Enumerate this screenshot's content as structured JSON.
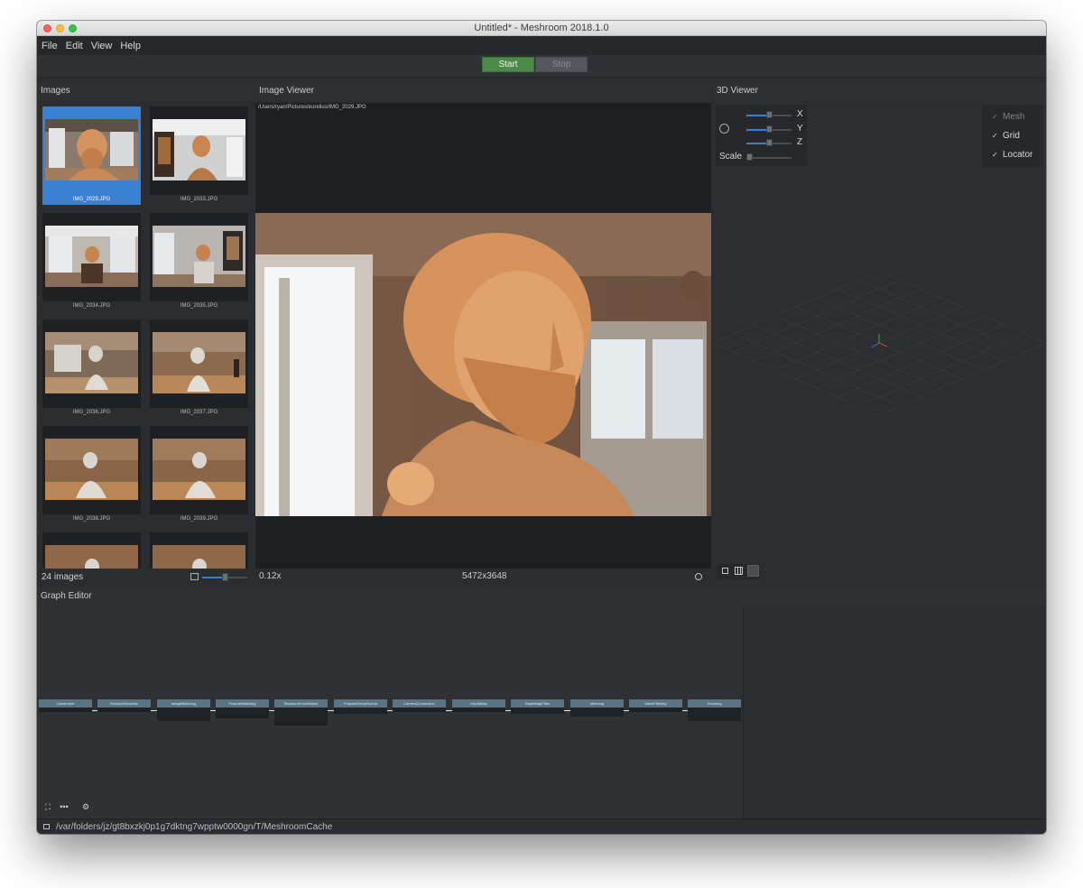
{
  "window": {
    "title": "Untitled* - Meshroom 2018.1.0"
  },
  "menu": [
    "File",
    "Edit",
    "View",
    "Help"
  ],
  "toolbar": {
    "start_label": "Start",
    "stop_label": "Stop"
  },
  "images_panel": {
    "title": "Images",
    "count_label": "24 images",
    "thumbnails": [
      {
        "name": "IMG_2029.JPG"
      },
      {
        "name": "IMG_2033.JPG"
      },
      {
        "name": "IMG_2034.JPG"
      },
      {
        "name": "IMG_2035.JPG"
      },
      {
        "name": "IMG_2036.JPG"
      },
      {
        "name": "IMG_2037.JPG"
      },
      {
        "name": "IMG_2038.JPG"
      },
      {
        "name": "IMG_2039.JPG"
      },
      {
        "name": ""
      },
      {
        "name": ""
      }
    ],
    "thumbnail_size": 0.5
  },
  "image_viewer": {
    "title": "Image Viewer",
    "path": "/Users/ryan/Pictures/eurelius/IMG_2029.JPG",
    "zoom": "0.12x",
    "resolution": "5472x3648"
  },
  "viewer_3d": {
    "title": "3D Viewer",
    "axes": {
      "x": "X",
      "y": "Y",
      "z": "Z"
    },
    "scale_label": "Scale",
    "toggles": [
      {
        "label": "Mesh",
        "enabled": false
      },
      {
        "label": "Grid",
        "enabled": true
      },
      {
        "label": "Locator",
        "enabled": true
      }
    ]
  },
  "graph_editor": {
    "title": "Graph Editor",
    "nodes": [
      "CameraInit",
      "FeatureExtraction",
      "ImageMatching",
      "FeatureMatching",
      "StructureFromMotion",
      "PrepareDenseScene",
      "CameraConnection",
      "DepthMap",
      "DepthMapFilter",
      "Meshing",
      "MeshFiltering",
      "Texturing"
    ]
  },
  "status": {
    "cache_path": "/var/folders/jz/gt8bxzkj0p1g7dktng7wpptw0000gn/T/MeshroomCache"
  },
  "colors": {
    "accent": "#3a80d2",
    "start": "#4a8b4a",
    "node_header": "#5a7483"
  }
}
